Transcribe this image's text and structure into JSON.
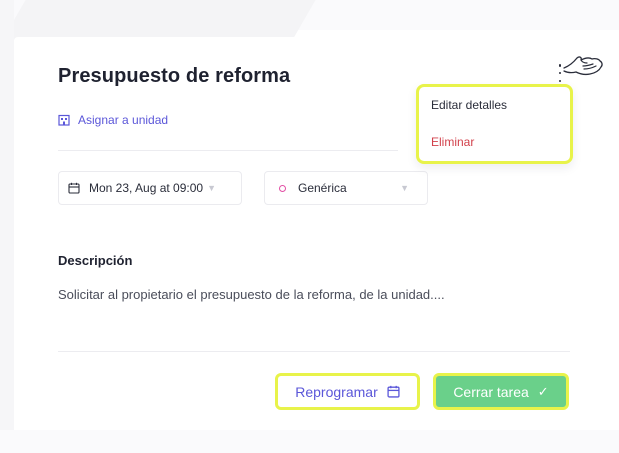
{
  "task": {
    "title": "Presupuesto de reforma",
    "assign_link": "Asignar a unidad",
    "date": "Mon 23, Aug at 09:00",
    "type": "Genérica",
    "description_heading": "Descripción",
    "description": "Solicitar al propietario el presupuesto de la reforma, de la unidad...."
  },
  "menu": {
    "items": [
      {
        "label": "Editar detalles"
      },
      {
        "label": "Eliminar"
      }
    ]
  },
  "actions": {
    "reschedule_label": "Reprogramar",
    "close_label": "Cerrar tarea"
  },
  "icons": {
    "assign": "building-icon",
    "date": "calendar-icon",
    "type": "circle-dot-icon",
    "reschedule": "calendar-icon",
    "close": "check-icon",
    "menu": "kebab-icon",
    "cursor": "pointing-hand-icon"
  },
  "colors": {
    "accent": "#5b57d9",
    "success": "#6ad08a",
    "danger": "#d2414b",
    "type_dot": "#e24fa5",
    "highlight": "#e8f34a"
  }
}
